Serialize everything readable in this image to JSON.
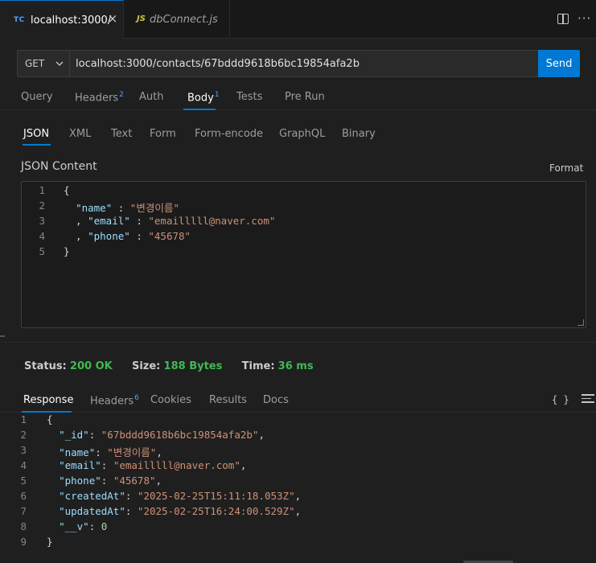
{
  "tabs": [
    {
      "badge": "TC",
      "label": "localhost:3000/",
      "close": "×"
    },
    {
      "badge": "JS",
      "label": "dbConnect.js"
    }
  ],
  "more_glyph": "···",
  "request": {
    "method": "GET",
    "url": "localhost:3000/contacts/67bddd9618b6bc19854afa2b",
    "send_label": "Send"
  },
  "request_tabs": [
    {
      "label": "Query"
    },
    {
      "label": "Headers",
      "count": "2"
    },
    {
      "label": "Auth"
    },
    {
      "label": "Body",
      "count": "1"
    },
    {
      "label": "Tests"
    },
    {
      "label": "Pre Run"
    }
  ],
  "body_tabs": [
    "JSON",
    "XML",
    "Text",
    "Form",
    "Form-encode",
    "GraphQL",
    "Binary"
  ],
  "json_content_label": "JSON Content",
  "format_label": "Format",
  "editor": {
    "line_numbers": [
      "1",
      "2",
      "3",
      "4",
      "5"
    ],
    "name_key": "\"name\"",
    "name_value": "\"변경이름\"",
    "email_key": "\"email\"",
    "email_value": "\"emailllll@naver.com\"",
    "phone_key": "\"phone\"",
    "phone_value": "\"45678\""
  },
  "status": {
    "status_label": "Status:",
    "status_value": "200 OK",
    "size_label": "Size:",
    "size_value": "188 Bytes",
    "time_label": "Time:",
    "time_value": "36 ms"
  },
  "response_tabs": [
    {
      "label": "Response"
    },
    {
      "label": "Headers",
      "count": "6"
    },
    {
      "label": "Cookies"
    },
    {
      "label": "Results"
    },
    {
      "label": "Docs"
    }
  ],
  "braces_glyph": "{ }",
  "response": {
    "line_numbers": [
      "1",
      "2",
      "3",
      "4",
      "5",
      "6",
      "7",
      "8",
      "9"
    ],
    "id_key": "\"_id\"",
    "id_value": "\"67bddd9618b6bc19854afa2b\"",
    "name_key": "\"name\"",
    "name_value": "\"변경이름\"",
    "email_key": "\"email\"",
    "email_value": "\"emailllll@naver.com\"",
    "phone_key": "\"phone\"",
    "phone_value": "\"45678\"",
    "createdAt_key": "\"createdAt\"",
    "createdAt_value": "\"2025-02-25T15:11:18.053Z\"",
    "updatedAt_key": "\"updatedAt\"",
    "updatedAt_value": "\"2025-02-25T16:24:00.529Z\"",
    "v_key": "\"__v\"",
    "v_value": "0"
  },
  "colors": {
    "accent": "#0078d4",
    "status_ok": "#3fb950",
    "json_key": "#9cdcfe",
    "json_string": "#ce9178"
  }
}
